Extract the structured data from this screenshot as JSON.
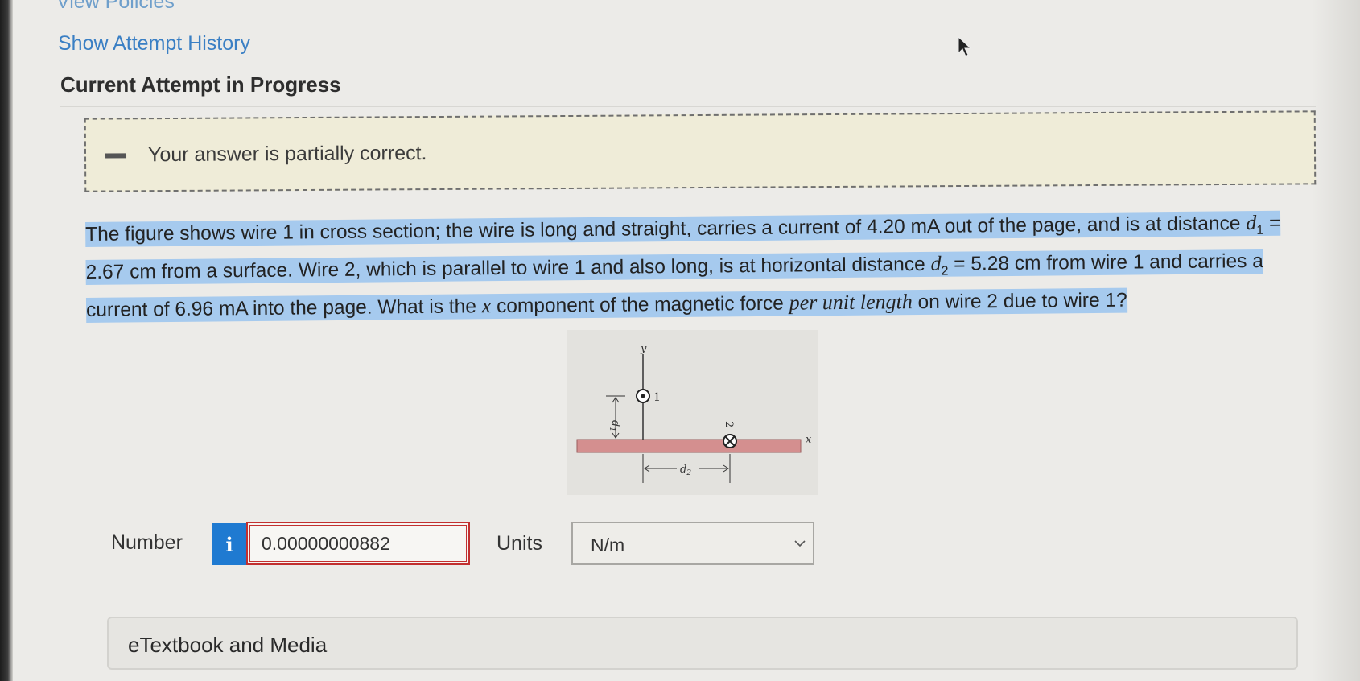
{
  "nav": {
    "view_policies": "View Policies",
    "show_attempt_history": "Show Attempt History",
    "current_attempt": "Current Attempt in Progress"
  },
  "feedback": {
    "icon": "minus-icon",
    "text": "Your answer is partially correct."
  },
  "question": {
    "p1": "The figure shows wire 1 in cross section; the wire is long and straight, carries a current of 4.20 mA out of the page, and is at distance ",
    "d1_symbol": "d",
    "d1_sub": "1",
    "p2": " = 2.67 cm from a surface. Wire 2, which is parallel to wire 1 and also long, is at horizontal distance ",
    "d2_symbol": "d",
    "d2_sub": "2",
    "p3": " = 5.28 cm from wire 1 and carries a current of 6.96 mA into the page. What is the ",
    "x_symbol": "x",
    "p4": " component of the magnetic force ",
    "p5_italic": "per unit length",
    "p6": " on wire 2 due to wire 1?"
  },
  "figure": {
    "y_label": "y",
    "x_label": "x",
    "wire1_label": "1",
    "wire2_label": "2",
    "d1_label": "d",
    "d1_sub": "1",
    "d2_label": "d",
    "d2_sub": "2",
    "surface_color": "#d48f8f"
  },
  "answer": {
    "number_label": "Number",
    "info_icon_char": "i",
    "number_value": "0.00000000882",
    "units_label": "Units",
    "units_value": "N/m"
  },
  "etextbook": {
    "label": "eTextbook and Media"
  },
  "colors": {
    "link": "#3a7fc4",
    "highlight": "#a6caee",
    "feedback_bg": "#efecd8",
    "info_button": "#1f7ad1",
    "input_error_border": "#c23030"
  }
}
